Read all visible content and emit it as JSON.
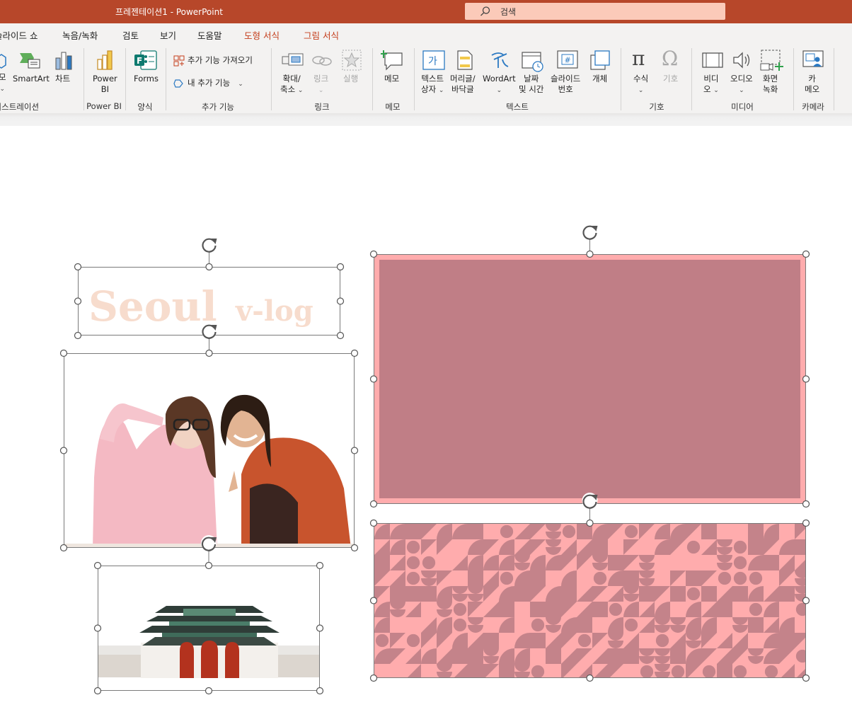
{
  "window": {
    "title": "프레젠테이션1  -  PowerPoint",
    "search_placeholder": "검색"
  },
  "tabs": [
    {
      "label": "슬라이드 쇼"
    },
    {
      "label": "녹음/녹화"
    },
    {
      "label": "검토"
    },
    {
      "label": "보기"
    },
    {
      "label": "도움말"
    },
    {
      "label": "도형 서식"
    },
    {
      "label": "그림 서식"
    }
  ],
  "ribbon": {
    "illustrations": {
      "partial_label": "모",
      "smartart": "SmartArt",
      "chart": "차트",
      "group": "일러스트레이션"
    },
    "powerbi": {
      "button_line1": "Power",
      "button_line2": "BI",
      "group": "Power BI"
    },
    "forms": {
      "button": "Forms",
      "group": "양식"
    },
    "addins": {
      "get": "추가 기능 가져오기",
      "my": "내 추가 기능",
      "group": "추가 기능"
    },
    "links": {
      "zoom_line1": "확대/",
      "zoom_line2": "축소",
      "link": "링크",
      "action": "실행",
      "group": "링크"
    },
    "comments": {
      "button": "메모",
      "group": "메모"
    },
    "text": {
      "textbox_line1": "텍스트",
      "textbox_line2": "상자",
      "header_line1": "머리글/",
      "header_line2": "바닥글",
      "wordart": "WordArt",
      "datetime_line1": "날짜",
      "datetime_line2": "및 시간",
      "slidenum_line1": "슬라이드",
      "slidenum_line2": "번호",
      "object": "개체",
      "group": "텍스트",
      "textbox_glyph": "가",
      "header_glyph": "",
      "slidenum_glyph": "#"
    },
    "symbols": {
      "equation": "수식",
      "symbol": "기호",
      "group": "기호"
    },
    "media": {
      "video_line1": "비디",
      "video_line2": "오",
      "audio": "오디오",
      "record_line1": "화면",
      "record_line2": "녹화",
      "group": "미디어"
    },
    "camera": {
      "cameo_line1": "카",
      "cameo_line2": "메오",
      "group": "카메라"
    }
  },
  "slide": {
    "title_text_word1": "Seoul",
    "title_text_word2": "v-log",
    "photo_people": "two-women-vlog-photo",
    "photo_palace": "gyeongbokgung-gate-photo",
    "colors": {
      "title_brand": "#b7472a",
      "text_peach": "#f7dccd",
      "mauve": "#c07e86",
      "pink": "#ffacad",
      "pattern_bg": "#ffacad",
      "pattern_fg": "#c4838a"
    }
  }
}
